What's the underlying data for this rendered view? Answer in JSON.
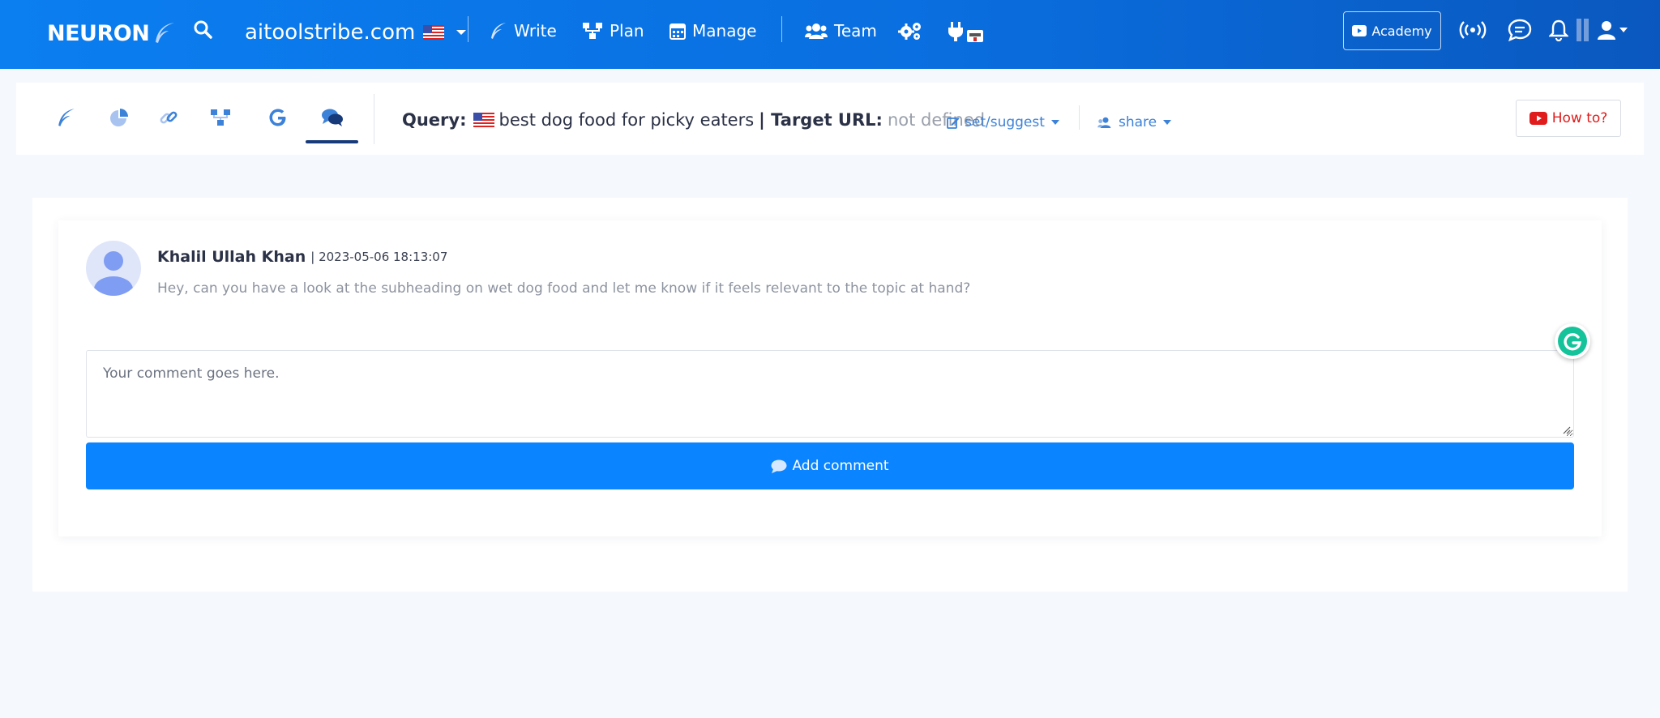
{
  "topbar": {
    "logo": "NEURON",
    "site": "aitoolstribe.com",
    "nav": {
      "write": "Write",
      "plan": "Plan",
      "manage": "Manage",
      "team": "Team"
    },
    "academy": "Academy",
    "icons": [
      "search-icon",
      "flag-us-icon",
      "gears-icon",
      "plug-icon",
      "broadcast-icon",
      "chat-icon",
      "bell-icon",
      "user-icon"
    ]
  },
  "subbar": {
    "tabs": [
      "feather-icon",
      "pie-chart-icon",
      "link-icon",
      "sitemap-icon",
      "google-icon",
      "comments-icon"
    ],
    "active_tab": "comments",
    "query_label": "Query:",
    "query_value": "best dog food for picky eaters",
    "target_label": "| Target URL:",
    "target_value": "not defined",
    "set_suggest": "set/suggest",
    "share": "share",
    "how_to": "How to?"
  },
  "comment": {
    "author": "Khalil Ullah Khan",
    "timestamp": "| 2023-05-06 18:13:07",
    "text": "Hey, can you have a look at the subheading on wet dog food and let me know if it feels relevant to the topic at hand?"
  },
  "composer": {
    "placeholder": "Your comment goes here.",
    "button": "Add comment"
  },
  "colors": {
    "topbar": "#0a6fe0",
    "primary_button": "#0a84ff",
    "accent_link": "#3c82d8",
    "how_to": "#e01c1c"
  }
}
